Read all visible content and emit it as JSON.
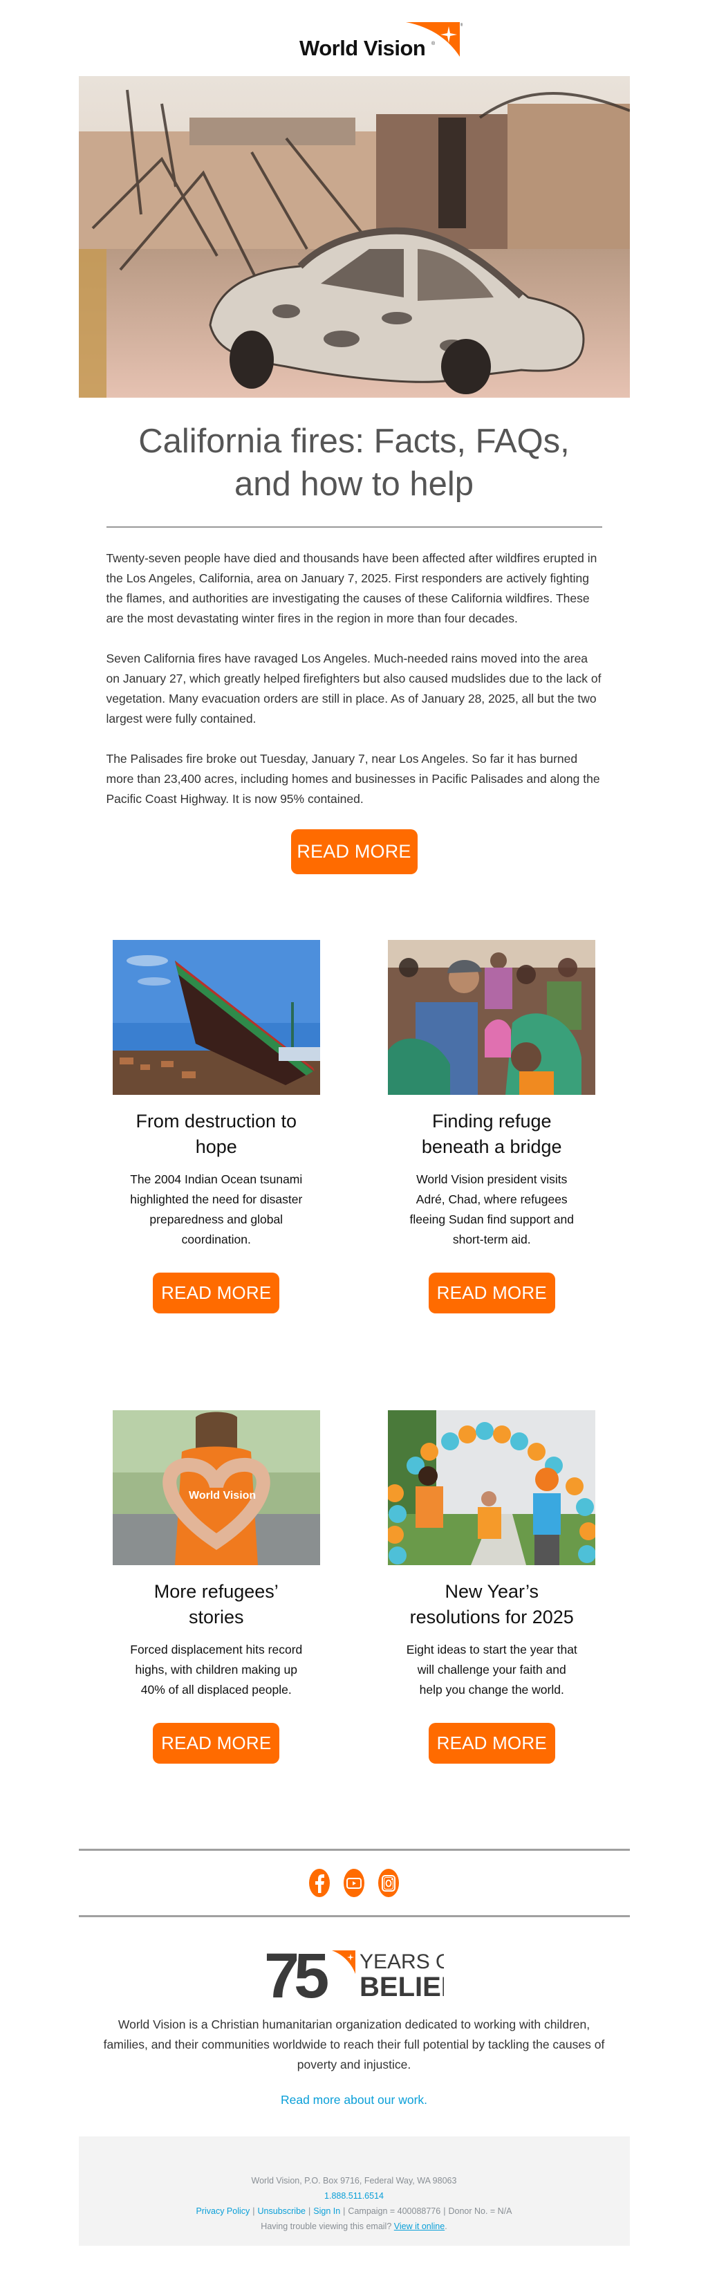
{
  "brand": {
    "name": "World Vision",
    "accent_color": "#ff6b00",
    "link_color": "#0a9fd8",
    "logo_icon": "world-vision-star-swoosh-icon"
  },
  "hero": {
    "image_alt": "Burned-out car among the ruins of homes destroyed by wildfire"
  },
  "article": {
    "title": "California fires: Facts, FAQs, and how to help",
    "paragraphs": [
      "Twenty-seven people have died and thousands have been affected after wildfires erupted in the Los Angeles, California, area on January 7, 2025. First responders are actively fighting the flames, and authorities are investigating the causes of these California wildfires. These are the most devastating winter fires in the region in more than four decades.",
      "Seven California fires have ravaged Los Angeles. Much-needed rains moved into the area on January 27, which greatly helped firefighters but also caused mudslides due to the lack of vegetation. Many evacuation orders are still in place. As of January 28, 2025, all but the two largest were fully contained.",
      "The Palisades fire broke out Tuesday, January 7, near Los Angeles. So far it has burned more than 23,400 acres, including homes and businesses in Pacific Palisades and along the Pacific Coast Highway. It is now 95% contained."
    ],
    "button_label": "READ MORE"
  },
  "cards": [
    {
      "image_alt": "Large wrecked fishing boat stranded on tsunami debris",
      "title": "From destruction to hope",
      "description": "The 2004 Indian Ocean tsunami highlighted the need for disaster preparedness and global coordination.",
      "button_label": "READ MORE"
    },
    {
      "image_alt": "World Vision president in a cap talking with refugee women and children",
      "title": "Finding refuge beneath a bridge",
      "description": "World Vision president visits Adré, Chad, where refugees fleeing Sudan find support and short-term aid.",
      "button_label": "READ MORE"
    },
    {
      "image_alt": "Hands forming a heart over an orange World Vision shirt",
      "title": "More refugees’ stories",
      "description": "Forced displacement hits record highs, with children making up 40% of all displaced people.",
      "button_label": "READ MORE"
    },
    {
      "image_alt": "Runners jumping under an orange and teal balloon arch",
      "title": "New Year’s resolutions for 2025",
      "description": "Eight ideas to start the year that will challenge your faith and help you change the world.",
      "button_label": "READ MORE"
    }
  ],
  "social": [
    {
      "name": "facebook",
      "icon": "facebook-icon"
    },
    {
      "name": "youtube",
      "icon": "youtube-icon"
    },
    {
      "name": "instagram",
      "icon": "instagram-icon"
    }
  ],
  "anniversary": {
    "number": "75",
    "line1": "YEARS OF",
    "line2": "BELIEF"
  },
  "about": {
    "text": "World Vision is a Christian humanitarian organization dedicated to working with children, families, and their communities worldwide to reach their full potential by tackling the causes of poverty and injustice.",
    "link_label": "Read more about our work."
  },
  "footer": {
    "address": "World Vision, P.O. Box 9716, Federal Way, WA 98063",
    "phone": "1.888.511.6514",
    "links": {
      "privacy": "Privacy Policy",
      "unsubscribe": "Unsubscribe",
      "sign_in": "Sign In"
    },
    "campaign": "Campaign = 400088776",
    "donor": "Donor No. = N/A",
    "trouble_text": "Having trouble viewing this email?",
    "view_online": "View it online",
    "trouble_end": "."
  }
}
